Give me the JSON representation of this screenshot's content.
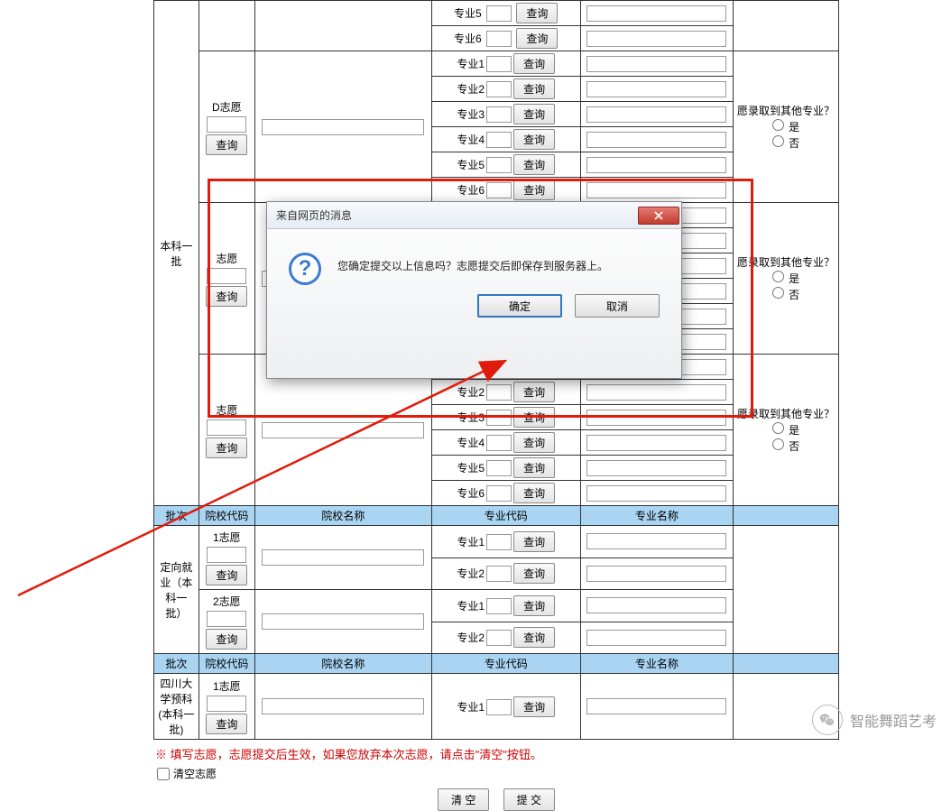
{
  "labels": {
    "query": "查询",
    "major_prefix": "专业",
    "wish_suffix": "志愿",
    "wish_d": "D志愿",
    "wish_1": "1志愿",
    "wish_2": "2志愿"
  },
  "batch_top": "本科一批",
  "obey": {
    "prompt": "愿录取到其他专业？",
    "yes": "是",
    "no": "否"
  },
  "columns": {
    "batch": "批次",
    "school_code": "院校代码",
    "school_name": "院校名称",
    "major_code": "专业代码",
    "major_name": "专业名称"
  },
  "batch2": "定向就业（本科一批）",
  "batch3": "四川大学预科(本科一批)",
  "hint": {
    "prefix": "※ 填写志愿，",
    "red1": "志愿提交后生效",
    "mid": "，如果您放弃本次志愿，请点击",
    "quote": "\"清空\"",
    "suffix": "按钮。"
  },
  "clear_checkbox": "清空志愿",
  "buttons": {
    "clear": "清 空",
    "submit": "提 交"
  },
  "dialog": {
    "title": "来自网页的消息",
    "message": "您确定提交以上信息吗？志愿提交后即保存到服务器上。",
    "ok": "确定",
    "cancel": "取消"
  },
  "watermark": "智能舞蹈艺考",
  "major_group_a_count": 6,
  "major_group_b_count": 6,
  "major_group_c_count": 6,
  "majors_b2_1": 2,
  "majors_b2_2": 2,
  "majors_b3": 1
}
